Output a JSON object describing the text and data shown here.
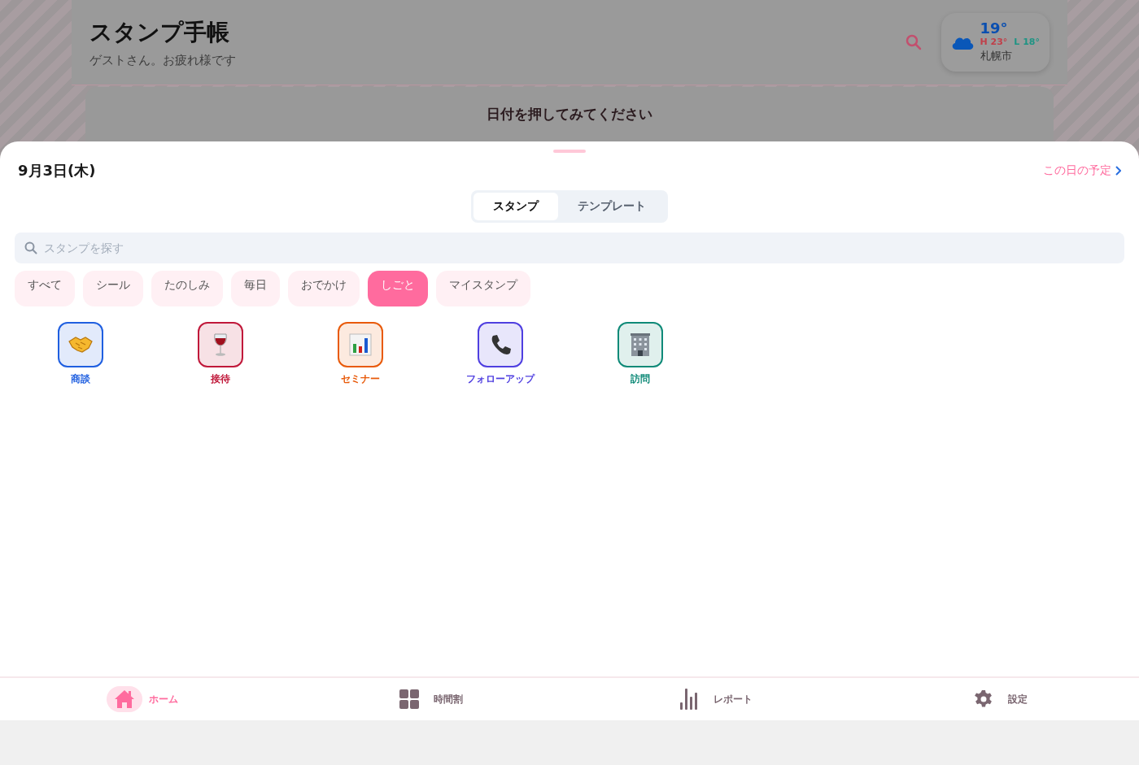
{
  "header": {
    "title": "スタンプ手帳",
    "greeting": "ゲストさん。お疲れ様です"
  },
  "weather": {
    "temp": "19°",
    "high": "H 23°",
    "low": "L 18°",
    "city": "札幌市"
  },
  "hint_card": {
    "title": "日付を押してみてください"
  },
  "sheet": {
    "date": "9月3日(木)",
    "day_link": "この日の予定",
    "tabs": [
      {
        "label": "スタンプ",
        "selected": true
      },
      {
        "label": "テンプレート",
        "selected": false
      }
    ],
    "search": {
      "placeholder": "スタンプを探す"
    },
    "categories": [
      {
        "label": "すべて",
        "selected": false
      },
      {
        "label": "シール",
        "selected": false
      },
      {
        "label": "たのしみ",
        "selected": false
      },
      {
        "label": "毎日",
        "selected": false
      },
      {
        "label": "おでかけ",
        "selected": false
      },
      {
        "label": "しごと",
        "selected": true
      },
      {
        "label": "マイスタンプ",
        "selected": false
      }
    ],
    "stamps": [
      {
        "label": "商談",
        "color": "#1f5fe0"
      },
      {
        "label": "接待",
        "color": "#c0183a"
      },
      {
        "label": "セミナー",
        "color": "#e85a0a"
      },
      {
        "label": "フォローアップ",
        "color": "#4f3fe0"
      },
      {
        "label": "訪問",
        "color": "#0f8a78"
      }
    ]
  },
  "nav": [
    {
      "label": "ホーム",
      "selected": true
    },
    {
      "label": "時間割",
      "selected": false
    },
    {
      "label": "レポート",
      "selected": false
    },
    {
      "label": "設定",
      "selected": false
    }
  ]
}
